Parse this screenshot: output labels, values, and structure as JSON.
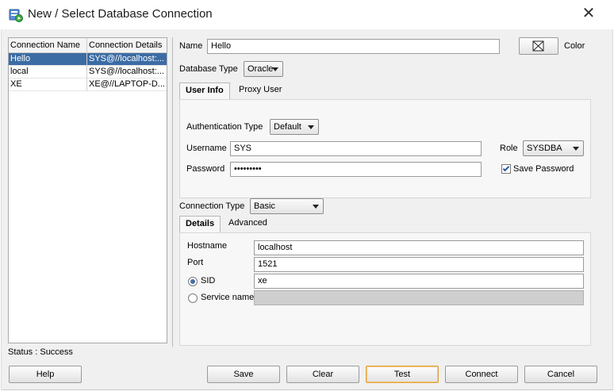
{
  "window": {
    "title": "New / Select Database Connection",
    "close_label": "✕"
  },
  "connections": {
    "headers": [
      "Connection Name",
      "Connection Details"
    ],
    "rows": [
      {
        "name": "Hello",
        "details": "SYS@//localhost:...",
        "selected": true
      },
      {
        "name": "local",
        "details": "SYS@//localhost:...",
        "selected": false
      },
      {
        "name": "XE",
        "details": "XE@//LAPTOP-D...",
        "selected": false
      }
    ]
  },
  "form": {
    "name_label": "Name",
    "name_value": "Hello",
    "color_label": "Color",
    "db_type_label": "Database Type",
    "db_type_value": "Oracle",
    "tabs": [
      "User Info",
      "Proxy User"
    ],
    "auth_type_label": "Authentication Type",
    "auth_type_value": "Default",
    "username_label": "Username",
    "username_value": "SYS",
    "password_label": "Password",
    "password_value": "•••••••••",
    "role_label": "Role",
    "role_value": "SYSDBA",
    "save_password_label": "Save Password",
    "save_password_checked": true,
    "conn_type_label": "Connection Type",
    "conn_type_value": "Basic",
    "details_tabs": [
      "Details",
      "Advanced"
    ],
    "hostname_label": "Hostname",
    "hostname_value": "localhost",
    "port_label": "Port",
    "port_value": "1521",
    "sid_label": "SID",
    "sid_value": "xe",
    "service_name_label": "Service name",
    "service_name_value": "",
    "sid_selected": true
  },
  "status": {
    "text": "Status : Success"
  },
  "buttons": {
    "help": "Help",
    "save": "Save",
    "clear": "Clear",
    "test": "Test",
    "connect": "Connect",
    "cancel": "Cancel"
  },
  "colors": {
    "selection": "#3c6ca4",
    "focus_border": "#e0a240"
  }
}
